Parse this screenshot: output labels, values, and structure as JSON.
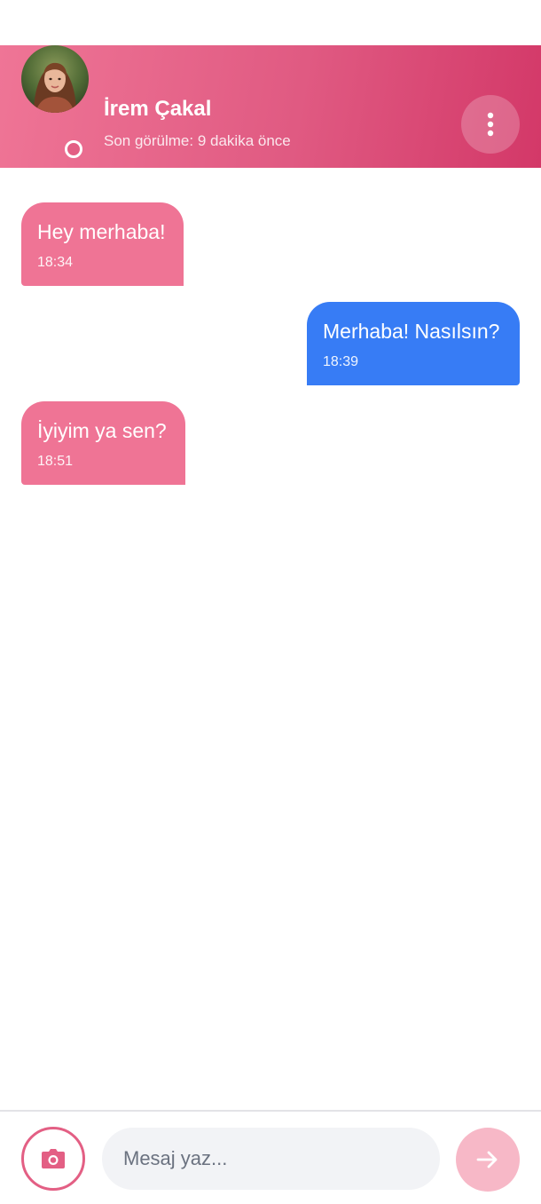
{
  "header": {
    "contact_name": "İrem Çakal",
    "last_seen": "Son görülme: 9 dakika önce",
    "online": true
  },
  "messages": [
    {
      "direction": "incoming",
      "text": "Hey merhaba!",
      "time": "18:34"
    },
    {
      "direction": "outgoing",
      "text": "Merhaba! Nasılsın?",
      "time": "18:39"
    },
    {
      "direction": "incoming",
      "text": "İyiyim ya sen?",
      "time": "18:51"
    }
  ],
  "composer": {
    "placeholder": "Mesaj yaz...",
    "value": ""
  },
  "icons": {
    "menu": "more-vertical-icon",
    "camera": "camera-icon",
    "send": "arrow-right-icon"
  },
  "colors": {
    "header_gradient_start": "#ef7596",
    "header_gradient_end": "#d33868",
    "incoming_bubble": "#ef7495",
    "outgoing_bubble": "#377cf5",
    "accent": "#e35f84",
    "send_button": "#f7b8c7"
  }
}
